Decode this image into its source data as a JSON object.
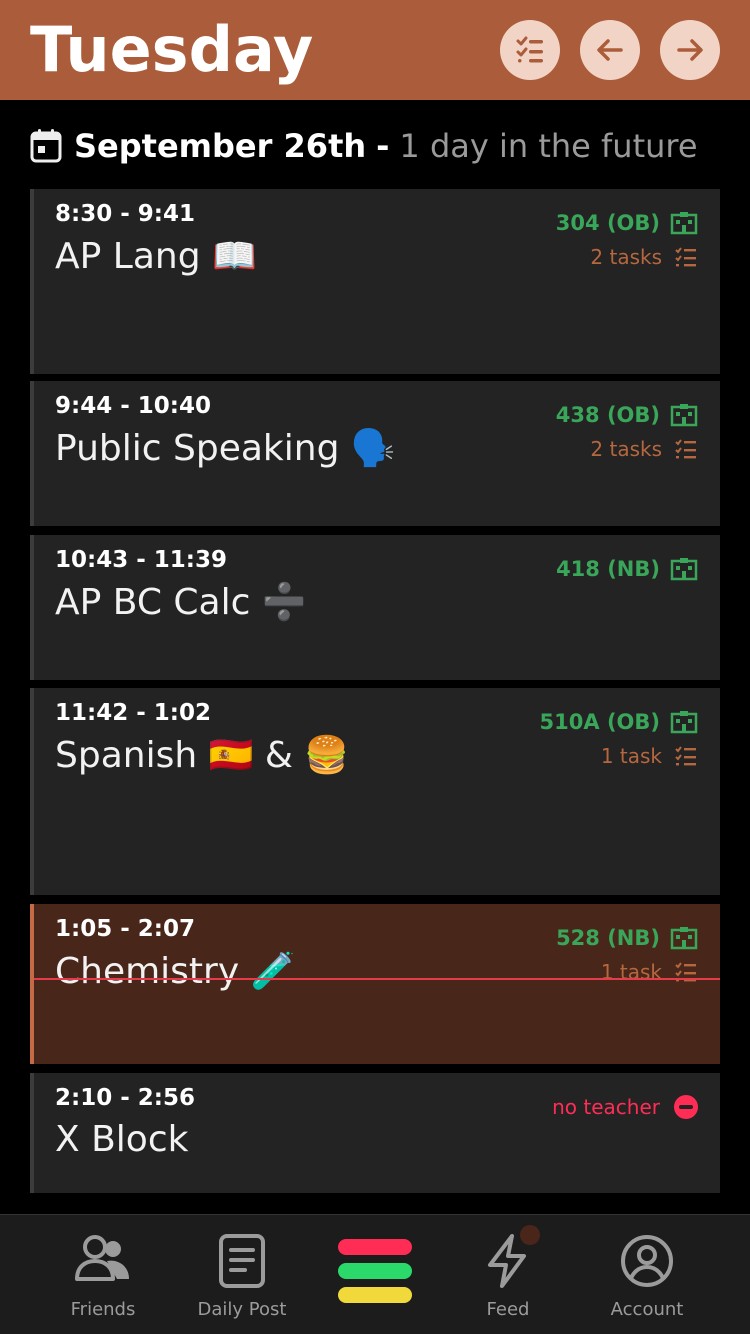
{
  "header": {
    "title": "Tuesday",
    "icons": [
      "task-list-icon",
      "arrow-left-icon",
      "arrow-right-icon"
    ]
  },
  "date": {
    "main": "September 26th",
    "separator": "-",
    "relative": "1 day in the future"
  },
  "classes": [
    {
      "time": "8:30 - 9:41",
      "name": "AP Lang 📖",
      "room": "304 (OB)",
      "tasks": "2 tasks"
    },
    {
      "time": "9:44 - 10:40",
      "name": "Public Speaking 🗣️",
      "room": "438 (OB)",
      "tasks": "2 tasks"
    },
    {
      "time": "10:43 - 11:39",
      "name": "AP BC Calc ➗",
      "room": "418 (NB)"
    },
    {
      "time": "11:42 - 1:02",
      "name": "Spanish 🇪🇸 & 🍔",
      "room": "510A (OB)",
      "tasks": "1 task"
    },
    {
      "time": "1:05 - 2:07",
      "name": "Chemistry 🧪",
      "room": "528 (NB)",
      "tasks": "1 task",
      "current": true
    },
    {
      "time": "2:10 - 2:56",
      "name": "X Block",
      "status": "no teacher"
    }
  ],
  "colors": {
    "header": "#ab5c3a",
    "room": "#3aa65a",
    "tasks": "#b5673f",
    "no_teacher": "#ff2d55",
    "now_line": "#e53b4a",
    "bar_red": "#ff2d55",
    "bar_green": "#2bd96b",
    "bar_yellow": "#f1d93b"
  },
  "nav": {
    "friends": "Friends",
    "daily_post": "Daily Post",
    "feed": "Feed",
    "account": "Account"
  }
}
